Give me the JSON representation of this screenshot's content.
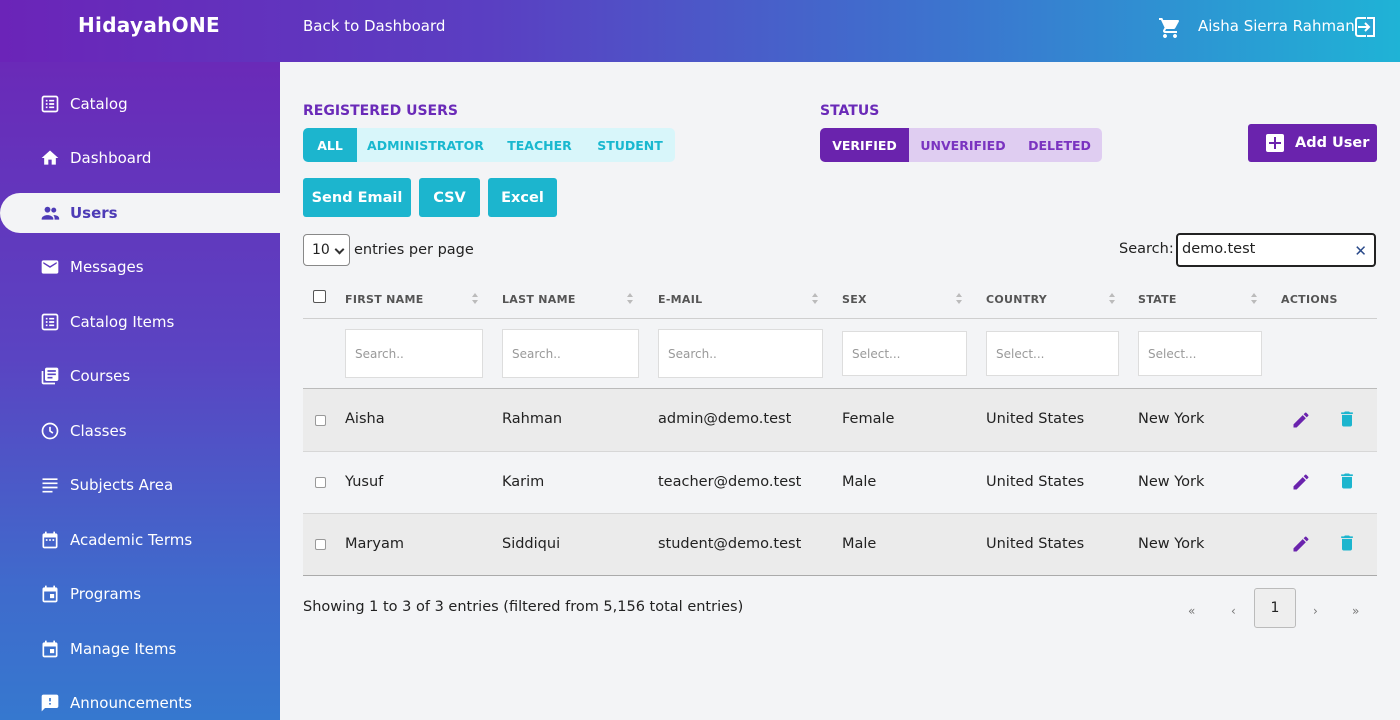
{
  "header": {
    "brand": "HidayahONE",
    "back_link": "Back to Dashboard",
    "user_name": "Aisha Sierra Rahman"
  },
  "sidebar": {
    "items": [
      {
        "label": "Catalog",
        "icon": "catalog-icon"
      },
      {
        "label": "Dashboard",
        "icon": "home-icon"
      },
      {
        "label": "Users",
        "icon": "users-icon",
        "active": true
      },
      {
        "label": "Messages",
        "icon": "mail-icon"
      },
      {
        "label": "Catalog Items",
        "icon": "catalog-items-icon"
      },
      {
        "label": "Courses",
        "icon": "courses-icon"
      },
      {
        "label": "Classes",
        "icon": "clock-icon"
      },
      {
        "label": "Subjects Area",
        "icon": "subjects-icon"
      },
      {
        "label": "Academic Terms",
        "icon": "calendar-icon"
      },
      {
        "label": "Programs",
        "icon": "programs-icon"
      },
      {
        "label": "Manage Items",
        "icon": "manage-items-icon"
      },
      {
        "label": "Announcements",
        "icon": "announcement-icon"
      }
    ]
  },
  "filters": {
    "roles_title": "REGISTERED USERS",
    "roles": [
      "ALL",
      "ADMINISTRATOR",
      "TEACHER",
      "STUDENT"
    ],
    "roles_selected": "ALL",
    "status_title": "STATUS",
    "statuses": [
      "VERIFIED",
      "UNVERIFIED",
      "DELETED"
    ],
    "status_selected": "VERIFIED"
  },
  "actions": {
    "add_user": "Add User",
    "send_email": "Send Email",
    "csv": "CSV",
    "excel": "Excel"
  },
  "table_controls": {
    "entries_value": "10",
    "entries_label": "entries per page",
    "search_label": "Search:",
    "search_value": "demo.test"
  },
  "table": {
    "columns": [
      "FIRST NAME",
      "LAST NAME",
      "E-MAIL",
      "SEX",
      "COUNTRY",
      "STATE",
      "ACTIONS"
    ],
    "filter_placeholders": [
      "Search..",
      "Search..",
      "Search..",
      "Select...",
      "Select...",
      "Select..."
    ],
    "rows": [
      {
        "first": "Aisha",
        "last": "Rahman",
        "email": "admin@demo.test",
        "sex": "Female",
        "country": "United States",
        "state": "New York"
      },
      {
        "first": "Yusuf",
        "last": "Karim",
        "email": "teacher@demo.test",
        "sex": "Male",
        "country": "United States",
        "state": "New York"
      },
      {
        "first": "Maryam",
        "last": "Siddiqui",
        "email": "student@demo.test",
        "sex": "Male",
        "country": "United States",
        "state": "New York"
      }
    ]
  },
  "footer": {
    "showing": "Showing 1 to 3 of 3 entries (filtered from 5,156 total entries)",
    "pager": {
      "first": "«",
      "prev": "‹",
      "current": "1",
      "next": "›",
      "last": "»"
    }
  },
  "colors": {
    "primary_purple": "#6a23ad",
    "accent_cyan": "#1cb5ce"
  }
}
